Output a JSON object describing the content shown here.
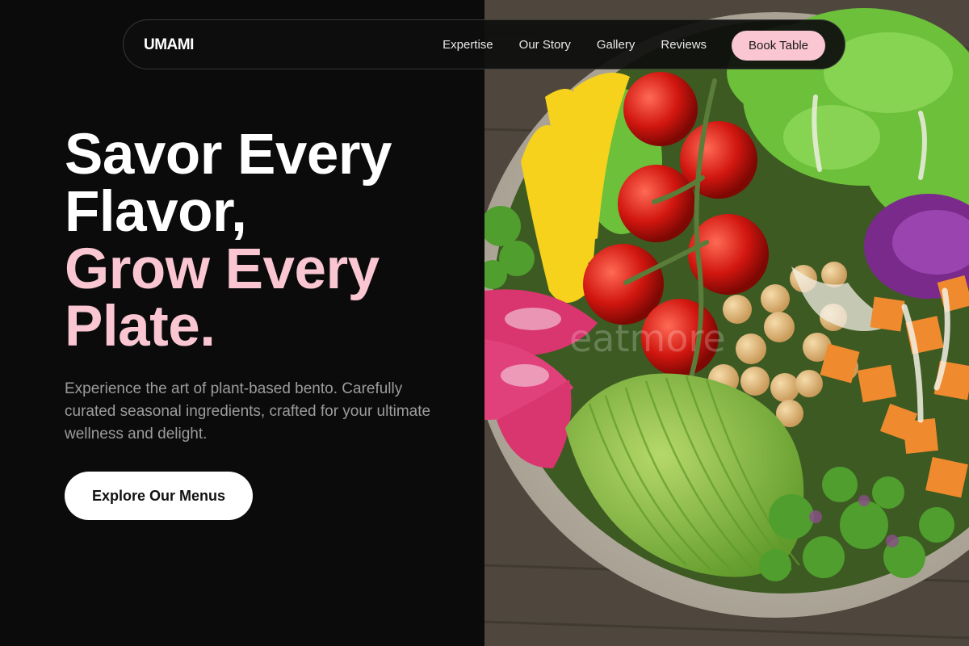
{
  "brand": "UMAMI",
  "nav": {
    "links": [
      "Expertise",
      "Our Story",
      "Gallery",
      "Reviews"
    ],
    "cta": "Book Table"
  },
  "hero": {
    "title_white_1": "Savor Every",
    "title_white_2": "Flavor,",
    "title_pink_1": "Grow Every",
    "title_pink_2": "Plate.",
    "subtitle": "Experience the art of plant-based bento. Carefully curated seasonal ingredients, crafted for your ultimate wellness and delight.",
    "cta": "Explore Our Menus"
  },
  "image": {
    "watermark": "eatmore"
  },
  "colors": {
    "background": "#0b0b0b",
    "accent_pink": "#f9c6d2",
    "text_white": "#ffffff",
    "text_muted": "#9c9c9c"
  }
}
